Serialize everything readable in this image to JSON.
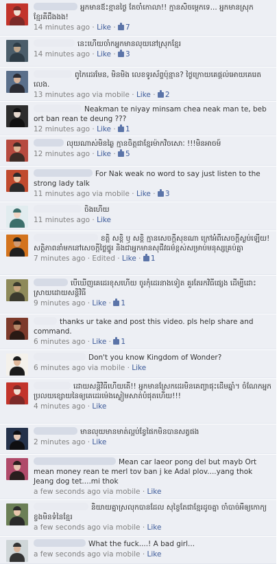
{
  "colors": {
    "link": "#3b5998",
    "meta_text": "#808080",
    "comment_background": "#edeff4"
  },
  "comments": [
    {
      "text": "អ្នកមានឪះខ្មានថ្ងៃ តែចាំកោលា!! ក្មានសិចម្ដេកទេ... អ្នកមានស្រុកខ្មែរគីជឹងងង!",
      "time": "14 minutes ago",
      "via": "",
      "like": "Like",
      "count": "7"
    },
    {
      "text": "នេះហើយចាំកអ្នកមានលុយនៅស្រុកខ្មែរ",
      "time": "14 minutes ago",
      "via": "",
      "like": "Like",
      "count": "3"
    },
    {
      "text": "ពូកៃដេរមែន, មិនមិង លេខទូរស័ព្ទប៉ុន្មាន? ថ្ងៃក្រោយគេផ្ដល់អោយគេរេតលេង.",
      "time": "13 minutes ago",
      "via": "via mobile",
      "like": "Like",
      "count": "2"
    },
    {
      "text": "Neakman te niyay minsam chea neak man te, beb ort ban rean te deung ???",
      "time": "12 minutes ago",
      "via": "",
      "like": "Like",
      "count": "1"
    },
    {
      "text": "លុយណាស់មិនឆ្ងៃ ក្មានចិត្ដជាខ្មែរម៉ាកវិចសោៈ !!!មិនអាចម៍",
      "time": "12 minutes ago",
      "via": "",
      "like": "Like",
      "count": "5"
    },
    {
      "text": "For Nak weak no word to say just listen to the strong lady talk",
      "time": "11 minutes ago",
      "via": "via mobile",
      "like": "Like",
      "count": "3"
    },
    {
      "text": "ចិងហើយ",
      "time": "11 minutes ago",
      "via": "",
      "like": "Like",
      "count": ""
    },
    {
      "text": "ខត្ដិ សខ្ដិ ឫ សខ្ដិ ក្មានសេចក្ដីសុខណា ក្រៅអំពីសេចក្ដីស្ងប់ឡើយ! សត្ដិភាពនាំមកនៅសេចក្ដីថ្លៃថ្នូរ និងជាអ្នកមានសុជីវធម៌ខ្ពស់សម្រាប់មនុស្សគ្រប់គ្នា",
      "time": "7 minutes ago",
      "via": "",
      "edited": "Edited",
      "like": "Like",
      "count": "1"
    },
    {
      "text": "បើឃើញគេដេរខុសហើយ ចូរកុំដេរនាងទៀត គួរតែរកវិធីផ្សេង ដើម្បីដោះស្រាយដោយសន្ដិវិធី",
      "time": "9 minutes ago",
      "via": "",
      "like": "Like",
      "count": "1"
    },
    {
      "text": "thanks ur take and post this video. pls help share and command.",
      "time": "6 minutes ago",
      "via": "",
      "like": "Like",
      "count": "1"
    },
    {
      "text": "Don't you know Kingdom of Wonder?",
      "time": "6 minutes ago",
      "via": "via mobile",
      "like": "Like",
      "count": ""
    },
    {
      "text": "ដោយសន្ដិវិធីហើយតើ!! អ្នកមានស្រែកដេរមិនគេញ្ចាផុះដើមឆ្នាំ។ ចំណែកអ្នកប្រលយខ្សោយនៃឲ្យគេដេរម៉េងស្ងៀមសាត់បំផុតហើយ!!!",
      "time": "4 minutes ago",
      "via": "",
      "like": "Like",
      "count": ""
    },
    {
      "text": "មានលុយមានមាត់ល្អប់ខ្វែផៃកមិនបានសត្វផង",
      "time": "2 minutes ago",
      "via": "",
      "like": "Like",
      "count": ""
    },
    {
      "text": "Mean car laeor pong del but mayb Ort mean money rean te merl tov ban j ke Adal plov....yang thok Jeang dog tet....mi thok",
      "time": "a few seconds ago",
      "via": "via mobile",
      "like": "Like",
      "count": ""
    },
    {
      "text": "និយាយគ្នាស្រលុកបានដែល សុខ្ចៃតែជាខ្មែរដូចគ្នា ចាំបាច់អីឲ្យកោក្យខ្ចងមិនទំនៃខ្មែរ",
      "time": "a few seconds ago",
      "via": "via mobile",
      "like": "Like",
      "count": ""
    },
    {
      "text": "What the fuck....! A bad girl...",
      "time": "a few seconds ago",
      "via": "via mobile",
      "like": "Like",
      "count": ""
    }
  ]
}
